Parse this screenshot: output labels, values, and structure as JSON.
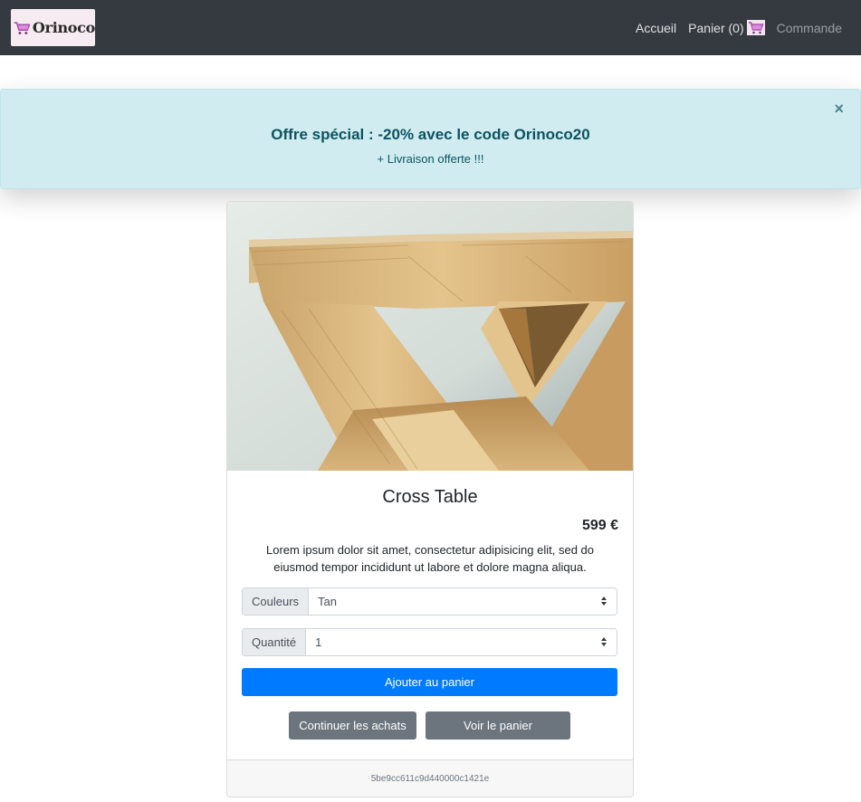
{
  "brand": {
    "logo_text": "Orinoco"
  },
  "nav": {
    "home": "Accueil",
    "cart": "Panier (0)",
    "order": "Commande"
  },
  "alert": {
    "title": "Offre spécial : -20% avec le code Orinoco20",
    "subtitle": "+ Livraison offerte !!!",
    "close": "×"
  },
  "product": {
    "name": "Cross Table",
    "price": "599 €",
    "description": "Lorem ipsum dolor sit amet, consectetur adipisicing elit, sed do eiusmod tempor incididunt ut labore et dolore magna aliqua.",
    "color_label": "Couleurs",
    "color_value": "Tan",
    "quantity_label": "Quantité",
    "quantity_value": "1",
    "add_to_cart": "Ajouter au panier",
    "continue_shopping": "Continuer les achats",
    "view_cart": "Voir le panier",
    "id": "5be9cc611c9d440000c1421e"
  },
  "colors": {
    "navbar": "#343a40",
    "alert_bg": "#d1ecf1",
    "alert_text": "#0c5460",
    "primary": "#007bff",
    "secondary": "#6c757d"
  },
  "icons": {
    "logo": "shopping-cart-icon",
    "cart": "cart-thumbnail-icon",
    "close": "close-icon",
    "select": "select-arrows-icon"
  }
}
